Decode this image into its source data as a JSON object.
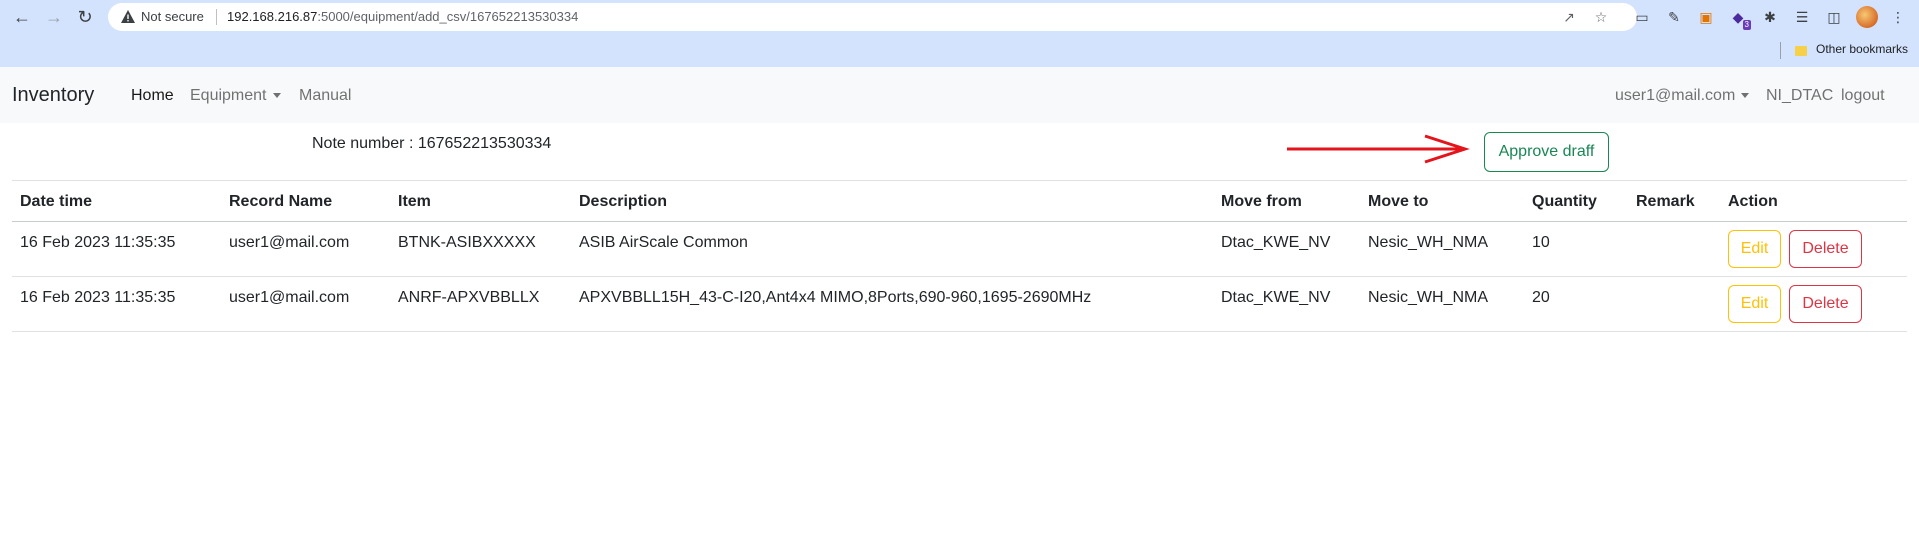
{
  "browser": {
    "security_label": "Not secure",
    "url_host": "192.168.216.87",
    "url_path": ":5000/equipment/add_csv/167652213530334",
    "extension_badge": "3",
    "other_bookmarks": "Other bookmarks"
  },
  "navbar": {
    "brand": "Inventory",
    "home": "Home",
    "equipment": "Equipment",
    "manual": "Manual",
    "user": "user1@mail.com",
    "org": "NI_DTAC",
    "logout": "logout"
  },
  "note": {
    "label": "Note number : 167652213530334"
  },
  "approve_label": "Approve draff",
  "table": {
    "headers": [
      "Date time",
      "Record Name",
      "Item",
      "Description",
      "Move from",
      "Move to",
      "Quantity",
      "Remark",
      "Action"
    ],
    "rows": [
      {
        "datetime": "16 Feb 2023 11:35:35",
        "record": "user1@mail.com",
        "item": "BTNK-ASIBXXXXX",
        "description": "ASIB AirScale Common",
        "move_from": "Dtac_KWE_NV",
        "move_to": "Nesic_WH_NMA",
        "quantity": "10",
        "remark": "",
        "edit": "Edit",
        "delete": "Delete"
      },
      {
        "datetime": "16 Feb 2023 11:35:35",
        "record": "user1@mail.com",
        "item": "ANRF-APXVBBLLX",
        "description": "APXVBBLL15H_43-C-I20,Ant4x4 MIMO,8Ports,690-960,1695-2690MHz",
        "move_from": "Dtac_KWE_NV",
        "move_to": "Nesic_WH_NMA",
        "quantity": "20",
        "remark": "",
        "edit": "Edit",
        "delete": "Delete"
      }
    ]
  },
  "colors": {
    "approve": "#198754",
    "edit": "#ffc107",
    "delete": "#dc3545",
    "arrow": "#e3141b"
  }
}
